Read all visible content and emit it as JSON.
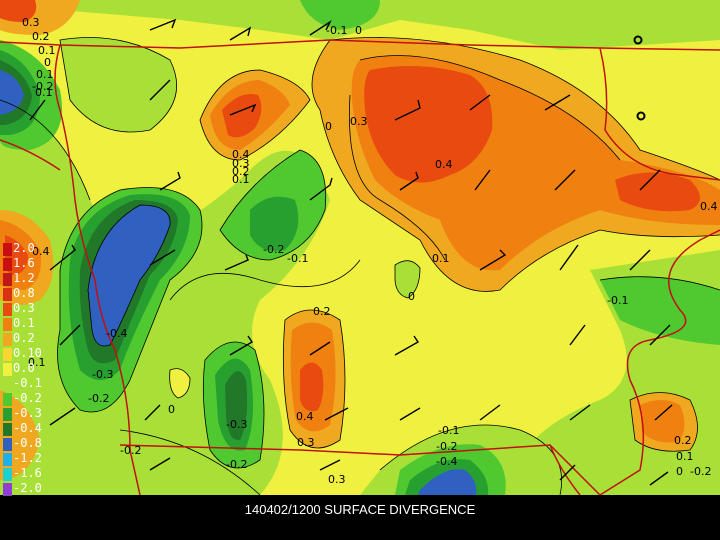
{
  "caption": "140402/1200 SURFACE DIVERGENCE",
  "legend": [
    {
      "label": "2.0",
      "color": "#c81010"
    },
    {
      "label": "1.6",
      "color": "#c81010"
    },
    {
      "label": "1.2",
      "color": "#c01818"
    },
    {
      "label": "0.8",
      "color": "#d83010"
    },
    {
      "label": "0.3",
      "color": "#e84a10"
    },
    {
      "label": "0.1",
      "color": "#f08010"
    },
    {
      "label": "0.2",
      "color": "#f0a820"
    },
    {
      "label": "0.10",
      "color": "#f8d830"
    },
    {
      "label": "0.0",
      "color": "#f0f040"
    },
    {
      "label": "-0.1",
      "color": "#a8e038"
    },
    {
      "label": "-0.2",
      "color": "#50c830"
    },
    {
      "label": "-0.3",
      "color": "#28a030"
    },
    {
      "label": "-0.4",
      "color": "#207828"
    },
    {
      "label": "-0.8",
      "color": "#3060c0"
    },
    {
      "label": "-1.2",
      "color": "#20b0e8"
    },
    {
      "label": "-1.6",
      "color": "#20d0d0"
    },
    {
      "label": "-2.0",
      "color": "#9040d0"
    }
  ],
  "contour_labels": [
    {
      "id": "c1",
      "text": "0.3"
    },
    {
      "id": "c2",
      "text": "0.2"
    },
    {
      "id": "c3",
      "text": "0.1"
    },
    {
      "id": "c4",
      "text": "0"
    },
    {
      "id": "c5",
      "text": "-0.1"
    },
    {
      "id": "c6",
      "text": "0.1"
    },
    {
      "id": "c7",
      "text": "-0.2"
    },
    {
      "id": "c8",
      "text": "0.1"
    },
    {
      "id": "c9",
      "text": "0"
    },
    {
      "id": "c10",
      "text": "0.3"
    },
    {
      "id": "c11",
      "text": "0.4"
    },
    {
      "id": "c12",
      "text": "0.4"
    },
    {
      "id": "c13",
      "text": "0.3"
    },
    {
      "id": "c14",
      "text": "0.2"
    },
    {
      "id": "c15",
      "text": "0.1"
    },
    {
      "id": "c16",
      "text": "-0.2"
    },
    {
      "id": "c17",
      "text": "-0.1"
    },
    {
      "id": "c18",
      "text": "0.1"
    },
    {
      "id": "c19",
      "text": "0"
    },
    {
      "id": "c20",
      "text": "-0.1"
    },
    {
      "id": "c21",
      "text": "0.4"
    },
    {
      "id": "c22",
      "text": "-0.4"
    },
    {
      "id": "c23",
      "text": "-0.3"
    },
    {
      "id": "c24",
      "text": "-0.2"
    },
    {
      "id": "c25",
      "text": "0.2"
    },
    {
      "id": "c26",
      "text": "0.4"
    },
    {
      "id": "c27",
      "text": "0.3"
    },
    {
      "id": "c28",
      "text": "0"
    },
    {
      "id": "c29",
      "text": "-0.3"
    },
    {
      "id": "c30",
      "text": "-0.2"
    },
    {
      "id": "c31",
      "text": "-0.2"
    },
    {
      "id": "c32",
      "text": "0.3"
    },
    {
      "id": "c33",
      "text": "-0.1"
    },
    {
      "id": "c34",
      "text": "-0.2"
    },
    {
      "id": "c35",
      "text": "-0.4"
    },
    {
      "id": "c36",
      "text": "0.2"
    },
    {
      "id": "c37",
      "text": "0.1"
    },
    {
      "id": "c38",
      "text": "0"
    },
    {
      "id": "c39",
      "text": "-0.2"
    },
    {
      "id": "c40",
      "text": "0.4"
    },
    {
      "id": "c41",
      "text": "0.1"
    },
    {
      "id": "c42",
      "text": "0"
    }
  ],
  "colors": {
    "background": "#000000",
    "state_border": "#c01010",
    "contour_line": "#000000"
  },
  "icons": [
    "wind-barb-icon",
    "station-circle-icon"
  ]
}
